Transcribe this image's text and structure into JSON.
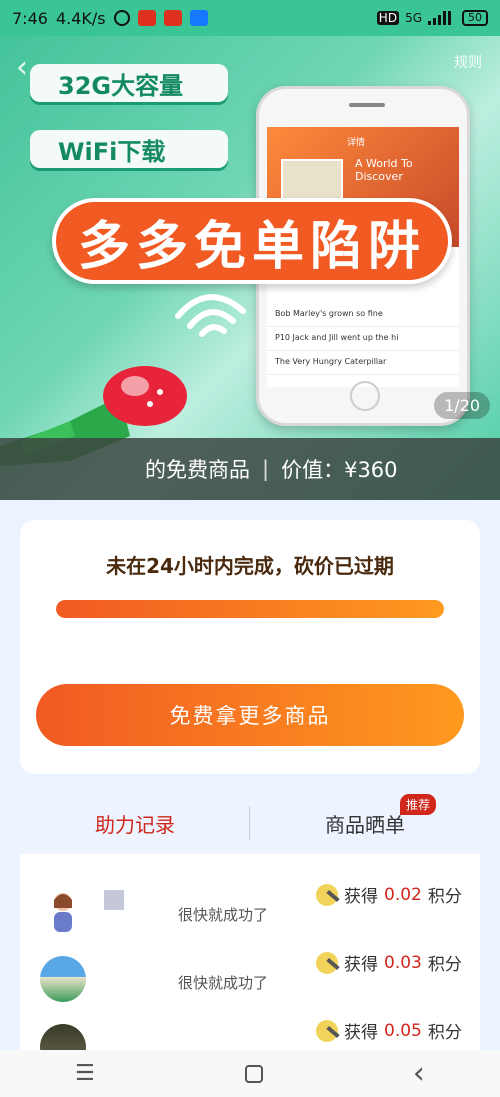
{
  "status_bar": {
    "time": "7:46",
    "speed": "4.4K/s",
    "network": "5G",
    "hd": "HD",
    "battery": "50"
  },
  "banner": {
    "pill1": "32G大容量",
    "pill2": "WiFi下载",
    "trap_text": "多多免单陷阱",
    "rules_link": "规则",
    "counter": "1/20",
    "info_prefix": "的免费商品",
    "info_value": "价值：¥360",
    "phone": {
      "header": "详情",
      "book_title": "A World To Discover",
      "rows": [
        "Bob Marley's grown so fine",
        "P10 Jack and Jill went up the hi",
        "The Very Hungry Caterpillar"
      ]
    }
  },
  "deal": {
    "expired_text": "未在24小时内完成，砍价已过期",
    "progress": 1.0,
    "cta": "免费拿更多商品"
  },
  "records": {
    "tabs": [
      "助力记录",
      "商品晒单"
    ],
    "badge": "推荐",
    "items": [
      {
        "status": "很快就成功了",
        "reward_prefix": "获得",
        "amount": "0.02",
        "reward_suffix": "积分"
      },
      {
        "status": "很快就成功了",
        "reward_prefix": "获得",
        "amount": "0.03",
        "reward_suffix": "积分"
      },
      {
        "status": "",
        "reward_prefix": "获得",
        "amount": "0.05",
        "reward_suffix": "积分"
      }
    ]
  },
  "nav": {
    "menu_icon": "☰",
    "back_icon": "‹"
  }
}
